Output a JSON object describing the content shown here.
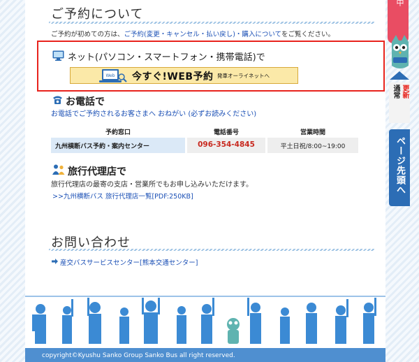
{
  "reservation": {
    "heading": "ご予約について",
    "notice_prefix": "ご予約が初めての方は、",
    "notice_link": "ご予約(変更・キャンセル・払い戻し)・購入について",
    "notice_suffix": "をご覧ください。"
  },
  "net": {
    "title": "ネット(パソコン・スマートフォン・携帯電話)で",
    "icon": "monitor-icon",
    "button_pc_label": "Web",
    "button_label": "今すぐ!WEB予約",
    "button_sublabel": "発車オーライネットへ"
  },
  "phone": {
    "title": "お電話で",
    "icon": "telephone-icon",
    "notice_link": "お電話でご予約されるお客さまへ おねがい (必ずお読みください)",
    "table": {
      "headers": [
        "予約窓口",
        "電話番号",
        "営業時間"
      ],
      "row": [
        "九州横断バス予約・案内センター",
        "096-354-4845",
        "平土日祝/8:00~19:00"
      ]
    }
  },
  "agency": {
    "title": "旅行代理店で",
    "icon": "people-icon",
    "text": "旅行代理店の最寄の支店・営業所でもお申し込みいただけます。",
    "link": ">>九州横断バス 旅行代理店一覧[PDF:250KB]"
  },
  "contact": {
    "heading": "お問い合わせ",
    "link": "産交バスサービスセンター[熊本交通センター]"
  },
  "side": {
    "tab_top_char": "中",
    "update_label_left": "通常",
    "update_label_right": "更新",
    "page_top": "ページ先頭へ"
  },
  "footer": {
    "copyright": "copyright©Kyushu Sanko Group Sanko Bus all right reserved."
  },
  "colors": {
    "accent_blue": "#2c6db5",
    "link_blue": "#1a4fb5",
    "highlight_red": "#e8231d",
    "phone_red": "#c8281e",
    "button_yellow": "#fbe9a8"
  }
}
